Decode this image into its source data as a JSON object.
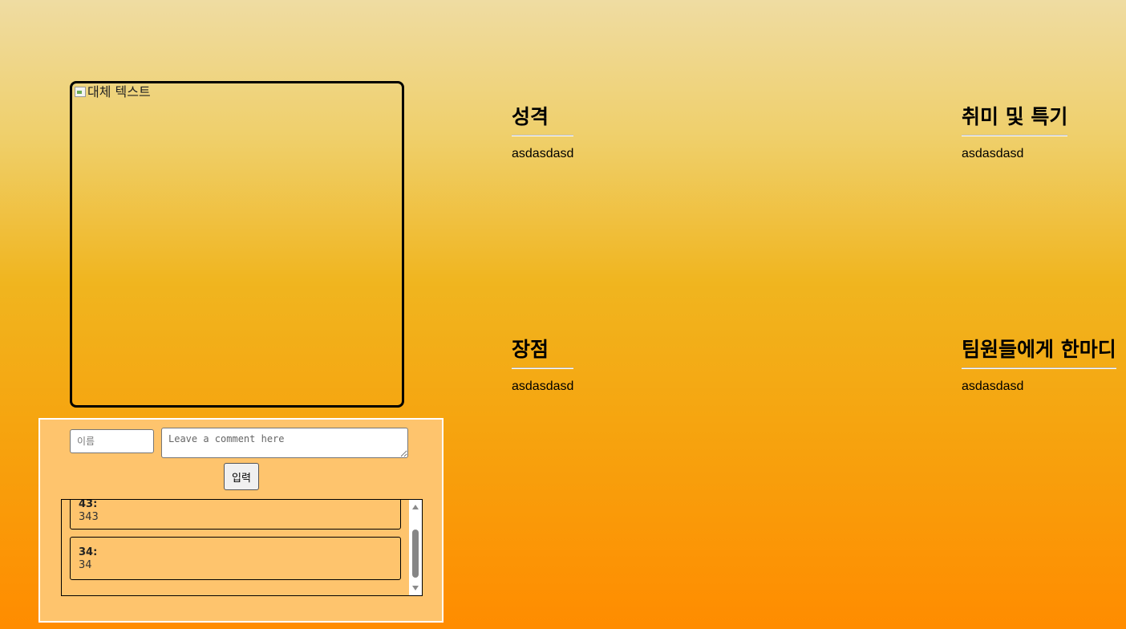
{
  "profile": {
    "photo_alt": "대체 텍스트"
  },
  "comments": {
    "name_placeholder": "이름",
    "comment_placeholder": "Leave a comment here",
    "submit_label": "입력",
    "items": [
      {
        "name": "43:",
        "text": "343"
      },
      {
        "name": "34:",
        "text": "34"
      }
    ]
  },
  "sections": {
    "personality": {
      "title": "성격",
      "body": "asdasdasd"
    },
    "hobby": {
      "title": "취미 및 특기",
      "body": "asdasdasd"
    },
    "strength": {
      "title": "장점",
      "body": "asdasdasd"
    },
    "message": {
      "title": "팀원들에게 한마디",
      "body": "asdasdasd"
    }
  }
}
